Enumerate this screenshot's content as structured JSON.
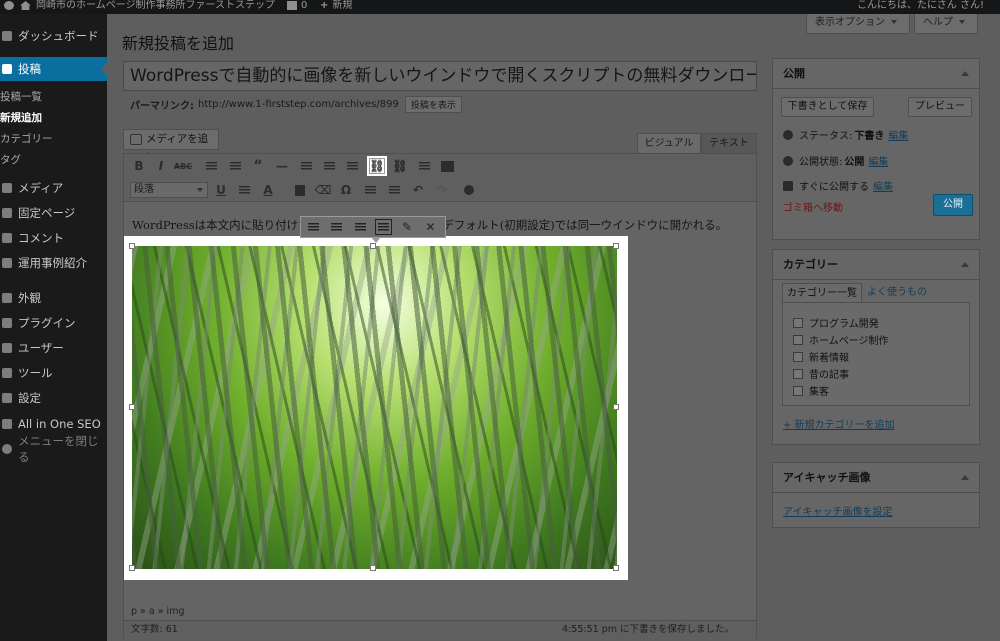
{
  "adminbar": {
    "site_name": "岡崎市のホームページ制作事務所ファーストステップ",
    "comments_count": "0",
    "new_label": "新規",
    "greeting": "こんにちは、たにさん さん!"
  },
  "sidebar": {
    "dashboard": "ダッシュボード",
    "posts": "投稿",
    "posts_sub": [
      "投稿一覧",
      "新規追加",
      "カテゴリー",
      "タグ"
    ],
    "media": "メディア",
    "pages": "固定ページ",
    "comments": "コメント",
    "cases": "運用事例紹介",
    "appearance": "外観",
    "plugins": "プラグイン",
    "users": "ユーザー",
    "tools": "ツール",
    "settings": "設定",
    "seo": "All in One SEO",
    "collapse": "メニューを閉じる"
  },
  "header": {
    "screen_options": "表示オプション",
    "help": "ヘルプ",
    "page_title": "新規投稿を追加"
  },
  "post": {
    "title": "WordPressで自動的に画像を新しいウインドウで開くスクリプトの無料ダウンロード",
    "permalink_label": "パーマリンク:",
    "permalink_url": "http://www.1-firststep.com/archives/899",
    "view_post": "投稿を表示"
  },
  "editor": {
    "add_media": "メディアを追加",
    "tab_visual": "ビジュアル",
    "tab_text": "テキスト",
    "format": "段落",
    "content_left": "WordPressは本文内に貼り付けた",
    "content_right": "と、デフォルト(初期設定)では同一ウインドウに開かれる。",
    "path": "p » a » img",
    "word_count": "文字数: 61",
    "saved_status": "4:55:51 pm に下書きを保存しました。",
    "toolbar_icons": [
      "bold",
      "italic",
      "strikethrough",
      "bullet-list",
      "numbered-list",
      "blockquote",
      "horizontal-rule",
      "align-left",
      "align-center",
      "align-right",
      "insert-link",
      "remove-link",
      "read-more",
      "toolbar-toggle"
    ]
  },
  "publish": {
    "title": "公開",
    "save_draft": "下書きとして保存",
    "preview": "プレビュー",
    "status_label": "ステータス:",
    "status_value": "下書き",
    "visibility_label": "公開状態:",
    "visibility_value": "公開",
    "schedule_label": "すぐに公開する",
    "edit": "編集",
    "trash": "ゴミ箱へ移動",
    "publish": "公開"
  },
  "categories": {
    "title": "カテゴリー",
    "tab_all": "カテゴリー一覧",
    "tab_popular": "よく使うもの",
    "items": [
      "プログラム開発",
      "ホームページ制作",
      "新着情報",
      "昔の記事",
      "集客"
    ],
    "add_new": "+ 新規カテゴリーを追加"
  },
  "featured": {
    "title": "アイキャッチ画像",
    "set_link": "アイキャッチ画像を設定"
  },
  "colors": {
    "accent": "#0a6f9f",
    "publish_button": "#1a6f96",
    "overlay": "#5e5e5e"
  }
}
